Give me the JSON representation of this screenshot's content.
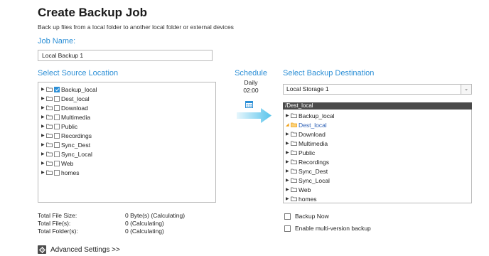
{
  "header": {
    "title": "Create Backup Job",
    "subtitle": "Back up files from a local folder to another local folder or external devices"
  },
  "job_name": {
    "label": "Job Name:",
    "value": "Local Backup 1"
  },
  "source": {
    "label": "Select Source Location",
    "items": [
      {
        "name": "Backup_local",
        "checked": true
      },
      {
        "name": "Dest_local",
        "checked": false
      },
      {
        "name": "Download",
        "checked": false
      },
      {
        "name": "Multimedia",
        "checked": false
      },
      {
        "name": "Public",
        "checked": false
      },
      {
        "name": "Recordings",
        "checked": false
      },
      {
        "name": "Sync_Dest",
        "checked": false
      },
      {
        "name": "Sync_Local",
        "checked": false
      },
      {
        "name": "Web",
        "checked": false
      },
      {
        "name": "homes",
        "checked": false
      }
    ]
  },
  "schedule": {
    "label": "Schedule",
    "frequency": "Daily",
    "time": "02:00",
    "icon": "calendar-icon"
  },
  "destination": {
    "label": "Select Backup Destination",
    "storage": "Local Storage 1",
    "path": "/Dest_local",
    "items": [
      {
        "name": "Backup_local",
        "open": false,
        "selected": false
      },
      {
        "name": "Dest_local",
        "open": true,
        "selected": true
      },
      {
        "name": "Download",
        "open": false,
        "selected": false
      },
      {
        "name": "Multimedia",
        "open": false,
        "selected": false
      },
      {
        "name": "Public",
        "open": false,
        "selected": false
      },
      {
        "name": "Recordings",
        "open": false,
        "selected": false
      },
      {
        "name": "Sync_Dest",
        "open": false,
        "selected": false
      },
      {
        "name": "Sync_Local",
        "open": false,
        "selected": false
      },
      {
        "name": "Web",
        "open": false,
        "selected": false
      },
      {
        "name": "homes",
        "open": false,
        "selected": false
      }
    ]
  },
  "stats": {
    "size_label": "Total File Size:",
    "size_value": "0 Byte(s) (Calculating)",
    "files_label": "Total File(s):",
    "files_value": "0 (Calculating)",
    "folders_label": "Total Folder(s):",
    "folders_value": "0 (Calculating)"
  },
  "options": {
    "backup_now": "Backup Now",
    "multi_version": "Enable multi-version backup"
  },
  "advanced": {
    "label": "Advanced Settings >>"
  },
  "colors": {
    "accent": "#2c8fd6",
    "arrow": "#59c4ec",
    "path_bar": "#4a4a4a",
    "open_folder": "#f0a21a"
  }
}
